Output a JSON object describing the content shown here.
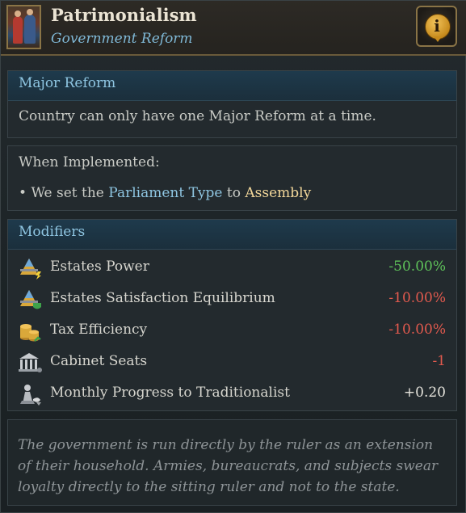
{
  "header": {
    "title": "Patrimonialism",
    "subtitle": "Government Reform",
    "portrait_icon": "ruler-portrait-icon",
    "info_icon": "info-icon"
  },
  "major_reform": {
    "heading": "Major Reform",
    "text": "Country can only have one Major Reform at a time."
  },
  "when_implemented": {
    "heading": "When Implemented:",
    "bullet": "•",
    "prefix": "We set the",
    "parliament_type": "Parliament Type",
    "connector": "to",
    "assembly": "Assembly"
  },
  "modifiers": {
    "heading": "Modifiers",
    "items": [
      {
        "icon": "estates-power-icon",
        "label": "Estates Power",
        "value": "-50.00%",
        "color": "#5fc35a"
      },
      {
        "icon": "estates-satisfaction-icon",
        "label": "Estates Satisfaction Equilibrium",
        "value": "-10.00%",
        "color": "#e35a4e"
      },
      {
        "icon": "tax-efficiency-icon",
        "label": "Tax Efficiency",
        "value": "-10.00%",
        "color": "#e35a4e"
      },
      {
        "icon": "cabinet-seats-icon",
        "label": "Cabinet Seats",
        "value": "-1",
        "color": "#e35a4e"
      },
      {
        "icon": "traditionalist-progress-icon",
        "label": "Monthly Progress to Traditionalist",
        "value": "+0.20",
        "color": "#e6e4dc"
      }
    ]
  },
  "description": "The government is run directly by the ruler as an extension of their household. Armies, bureaucrats, and subjects swear loyalty directly to the sitting ruler and not to the state."
}
